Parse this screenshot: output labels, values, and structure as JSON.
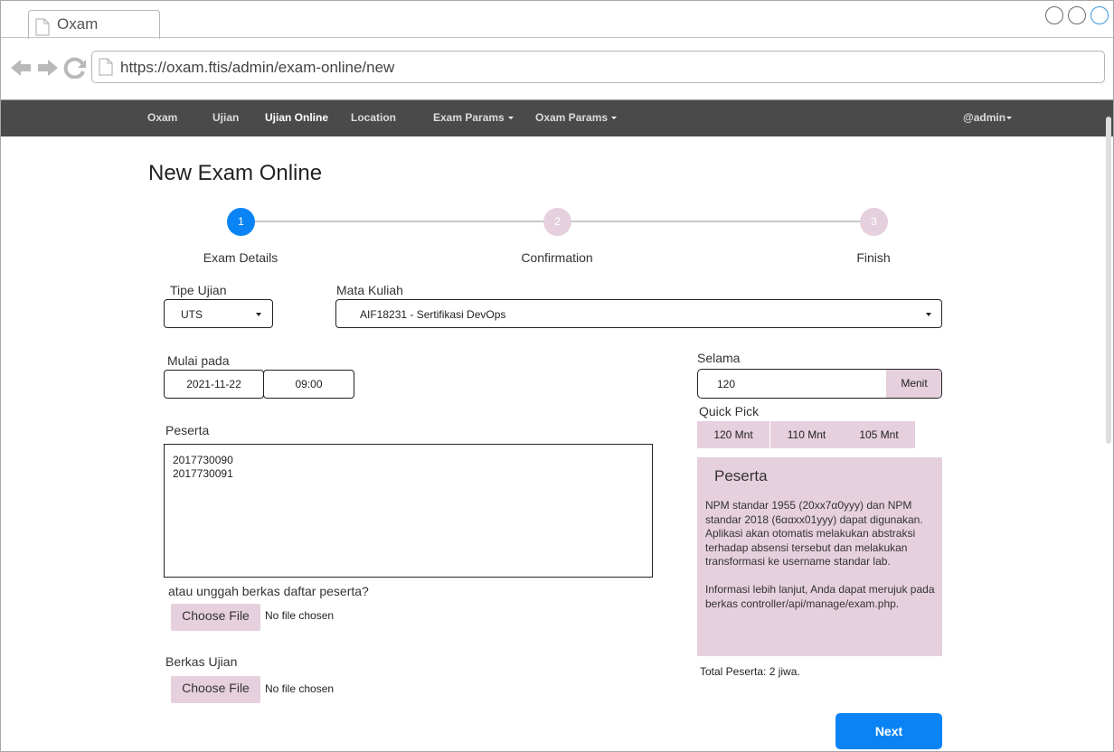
{
  "browser": {
    "tab_title": "Oxam",
    "url": "https://oxam.ftis/admin/exam-online/new"
  },
  "navbar": {
    "items": [
      {
        "label": "Oxam"
      },
      {
        "label": "Ujian"
      },
      {
        "label": "Ujian Online",
        "active": true
      },
      {
        "label": "Location"
      },
      {
        "label": "Exam Params"
      },
      {
        "label": "Oxam Params"
      }
    ],
    "user": "@admin"
  },
  "page": {
    "title": "New Exam Online"
  },
  "stepper": {
    "steps": [
      {
        "number": "1",
        "label": "Exam Details",
        "state": "active"
      },
      {
        "number": "2",
        "label": "Confirmation",
        "state": "inactive"
      },
      {
        "number": "3",
        "label": "Finish",
        "state": "inactive"
      }
    ]
  },
  "form": {
    "tipe_ujian": {
      "label": "Tipe Ujian",
      "value": "UTS"
    },
    "mata_kuliah": {
      "label": "Mata Kuliah",
      "value": "AIF18231 - Sertifikasi DevOps"
    },
    "mulai_pada": {
      "label": "Mulai pada",
      "date": "2021-11-22",
      "time": "09:00"
    },
    "selama": {
      "label": "Selama",
      "value": "120",
      "unit": "Menit"
    },
    "quick_pick": {
      "label": "Quick Pick",
      "options": [
        "120 Mnt",
        "110 Mnt",
        "105 Mnt"
      ]
    },
    "peserta": {
      "label": "Peserta",
      "lines": [
        "2017730090",
        "2017730091"
      ]
    },
    "upload_prompt": "atau unggah berkas daftar peserta?",
    "peserta_file": {
      "button": "Choose File",
      "status": "No file chosen"
    },
    "berkas_ujian": {
      "label": "Berkas Ujian",
      "button": "Choose File",
      "status": "No file chosen"
    }
  },
  "info_panel": {
    "title": "Peserta",
    "paragraph1": "NPM standar 1955 (20xx7α0yyy) dan NPM standar 2018 (6ααxx01yyy) dapat digunakan. Aplikasi akan otomatis melakukan abstraksi terhadap absensi tersebut dan melakukan transformasi ke username standar lab.",
    "paragraph2": "Informasi lebih lanjut, Anda dapat merujuk pada berkas controller/api/manage/exam.php."
  },
  "total_peserta": "Total Peserta: 2 jiwa.",
  "actions": {
    "next_label": "Next"
  },
  "colors": {
    "navbar_bg": "#4a4a4a",
    "primary": "#0a84f5",
    "accent_pink": "#e6d0dd"
  }
}
